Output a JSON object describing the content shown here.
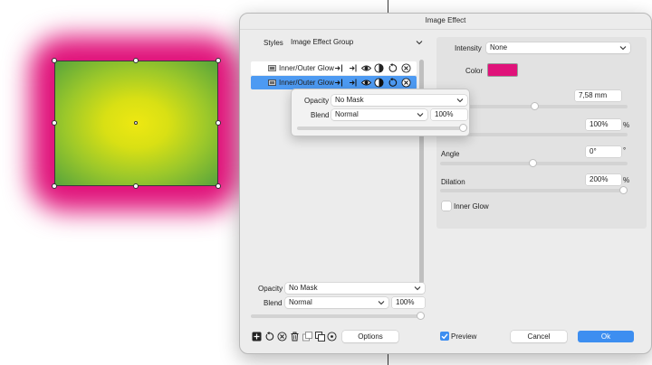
{
  "dialog": {
    "title": "Image Effect"
  },
  "styles": {
    "label": "Styles",
    "value": "Image Effect Group"
  },
  "effects_list": [
    {
      "label": "Inner/Outer Glow",
      "selected": false
    },
    {
      "label": "Inner/Outer Glow",
      "selected": true
    }
  ],
  "row_icons": [
    "merge-in-icon",
    "merge-out-icon",
    "eye-icon",
    "blend-icon",
    "reset-icon",
    "delete-icon"
  ],
  "popup": {
    "opacity_label": "Opacity",
    "opacity_value": "No Mask",
    "blend_label": "Blend",
    "blend_value": "Normal",
    "blend_percent": "100%",
    "slider_value": 100
  },
  "bottom": {
    "opacity_label": "Opacity",
    "opacity_value": "No Mask",
    "blend_label": "Blend",
    "blend_value": "Normal",
    "blend_percent": "100%",
    "slider_value": 100
  },
  "settings": {
    "intensity_label": "Intensity",
    "intensity_value": "None",
    "color_label": "Color",
    "color_hex": "#e0127a",
    "size_value": "7,58 mm",
    "percent_value": "100%",
    "percent_unit": "%",
    "angle_label": "Angle",
    "angle_value": "0°",
    "angle_unit": "°",
    "dilation_label": "Dilation",
    "dilation_value": "200%",
    "dilation_unit": "%",
    "inner_glow_label": "Inner Glow",
    "inner_glow_checked": false
  },
  "footer": {
    "options_label": "Options",
    "preview_label": "Preview",
    "preview_checked": true,
    "cancel_label": "Cancel",
    "ok_label": "Ok"
  },
  "toolbar_icons": [
    "add-icon",
    "reset-icon",
    "delete-circle-icon",
    "trash-icon",
    "duplicate-icon",
    "copy-icon",
    "target-icon"
  ],
  "colors": {
    "accent": "#3d8ef0",
    "selection": "#4d9af2",
    "glow": "#e0127a"
  }
}
